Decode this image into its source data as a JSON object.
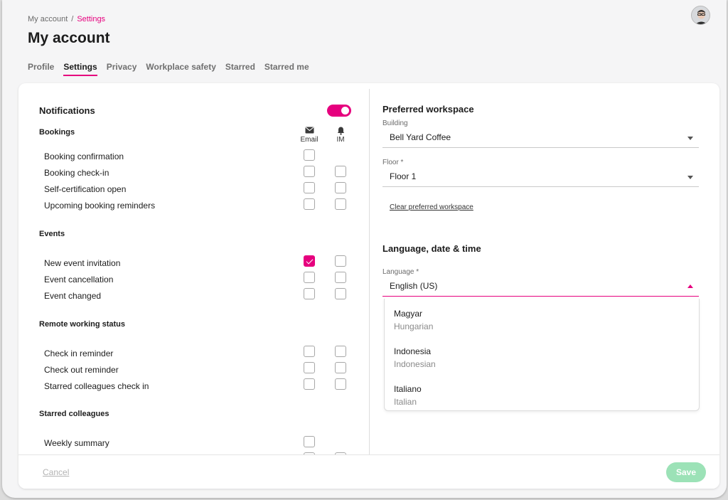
{
  "breadcrumb": {
    "root": "My account",
    "separator": "/",
    "current": "Settings"
  },
  "page_title": "My account",
  "tabs": [
    {
      "label": "Profile",
      "active": false
    },
    {
      "label": "Settings",
      "active": true
    },
    {
      "label": "Privacy",
      "active": false
    },
    {
      "label": "Workplace safety",
      "active": false
    },
    {
      "label": "Starred",
      "active": false
    },
    {
      "label": "Starred me",
      "active": false
    }
  ],
  "notifications": {
    "title": "Notifications",
    "enabled": true,
    "columns": {
      "email": "Email",
      "im": "IM"
    },
    "sections": {
      "bookings": {
        "title": "Bookings",
        "rows": [
          {
            "label": "Booking confirmation",
            "email": false,
            "im": null
          },
          {
            "label": "Booking check-in",
            "email": false,
            "im": false
          },
          {
            "label": "Self-certification open",
            "email": false,
            "im": false
          },
          {
            "label": "Upcoming booking reminders",
            "email": false,
            "im": false
          }
        ]
      },
      "events": {
        "title": "Events",
        "rows": [
          {
            "label": "New event invitation",
            "email": true,
            "im": false
          },
          {
            "label": "Event cancellation",
            "email": false,
            "im": false
          },
          {
            "label": "Event changed",
            "email": false,
            "im": false
          }
        ]
      },
      "remote": {
        "title": "Remote working status",
        "rows": [
          {
            "label": "Check in reminder",
            "email": false,
            "im": false
          },
          {
            "label": "Check out reminder",
            "email": false,
            "im": false
          },
          {
            "label": "Starred colleagues check in",
            "email": false,
            "im": false
          }
        ]
      },
      "starred": {
        "title": "Starred colleagues",
        "rows": [
          {
            "label": "Weekly summary",
            "email": false,
            "im": null
          }
        ]
      }
    }
  },
  "workspace": {
    "title": "Preferred workspace",
    "building_label": "Building",
    "building_value": "Bell Yard Coffee",
    "floor_label": "Floor *",
    "floor_value": "Floor 1",
    "clear_link": "Clear preferred workspace"
  },
  "language": {
    "title": "Language, date & time",
    "language_label": "Language *",
    "language_value": "English (US)",
    "options": [
      {
        "name": "Magyar",
        "english": "Hungarian"
      },
      {
        "name": "Indonesia",
        "english": "Indonesian"
      },
      {
        "name": "Italiano",
        "english": "Italian"
      }
    ]
  },
  "footer": {
    "cancel": "Cancel",
    "save": "Save"
  },
  "colors": {
    "accent": "#e6007e",
    "save_disabled": "#9ce2b7"
  }
}
